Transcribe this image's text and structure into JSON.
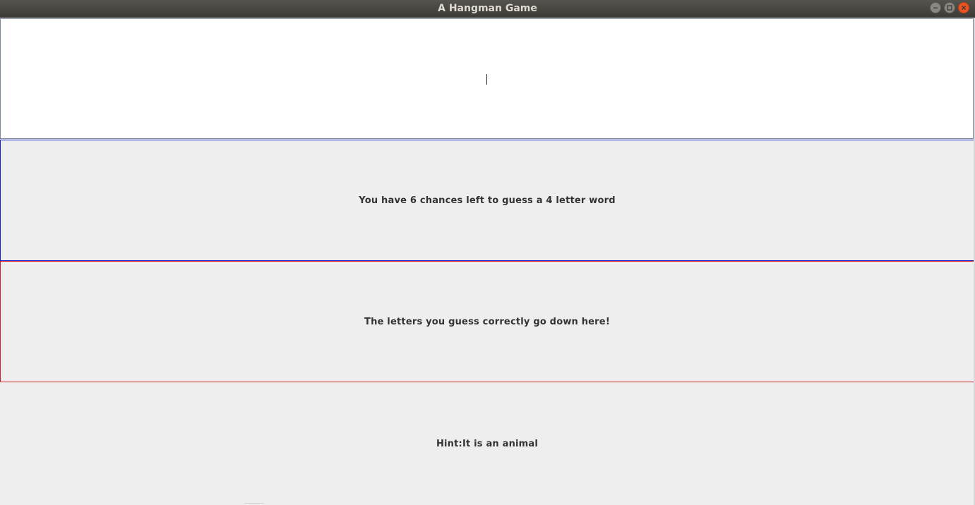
{
  "window": {
    "title": "A Hangman Game",
    "controls": {
      "minimize_icon": "minimize-icon",
      "maximize_icon": "maximize-icon",
      "close_icon": "close-icon"
    }
  },
  "guess_input": {
    "value": ""
  },
  "chances_panel": {
    "text": "You have 6 chances left to guess a 4 letter word",
    "border_color": "#1c1cc8"
  },
  "correct_letters_panel": {
    "text": "The letters you guess correctly go down here!",
    "border_color": "#d41e2c"
  },
  "hint_panel": {
    "text": "Hint:It is an animal"
  },
  "colors": {
    "titlebar": "#3c3b37",
    "title_text": "#dfdbd2",
    "close_button": "#e9541f",
    "window_bg": "#eeeeee"
  }
}
